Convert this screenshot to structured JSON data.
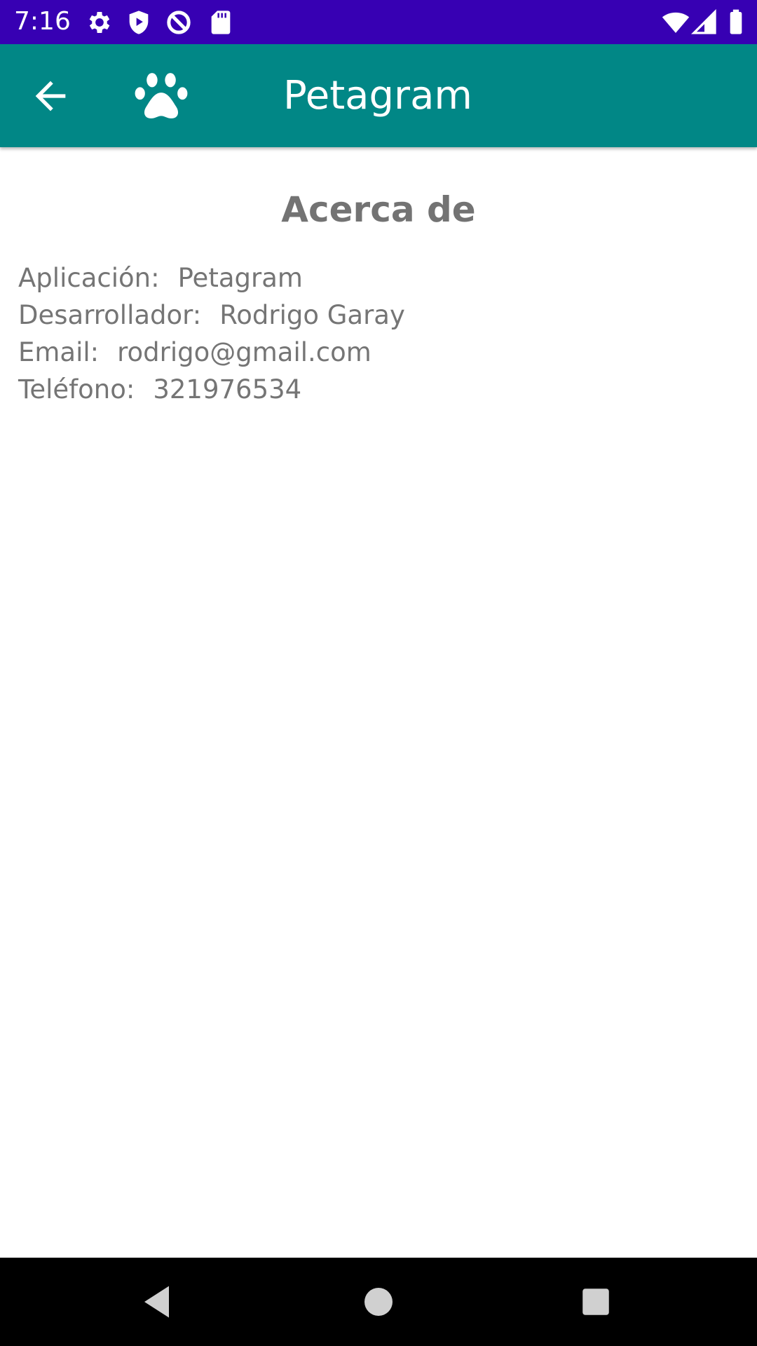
{
  "status_bar": {
    "time": "7:16",
    "icons": [
      "settings-icon",
      "shield-play-icon",
      "data-saver-icon",
      "sd-card-icon",
      "wifi-icon",
      "signal-icon",
      "battery-icon"
    ]
  },
  "app_bar": {
    "title": "Petagram",
    "back_icon": "arrow-back-icon",
    "logo_icon": "paw-icon",
    "background_color": "#018786"
  },
  "about": {
    "title": "Acerca de",
    "rows": [
      {
        "label": "Aplicación:",
        "value": "Petagram"
      },
      {
        "label": "Desarrollador:",
        "value": "Rodrigo Garay"
      },
      {
        "label": "Email:",
        "value": "rodrigo@gmail.com"
      },
      {
        "label": "Teléfono:",
        "value": "321976534"
      }
    ]
  },
  "nav_bar": {
    "buttons": [
      "back-triangle-icon",
      "home-circle-icon",
      "recents-square-icon"
    ]
  },
  "colors": {
    "status_bar": "#3700b3",
    "app_bar": "#018786",
    "text_gray": "#757575"
  }
}
